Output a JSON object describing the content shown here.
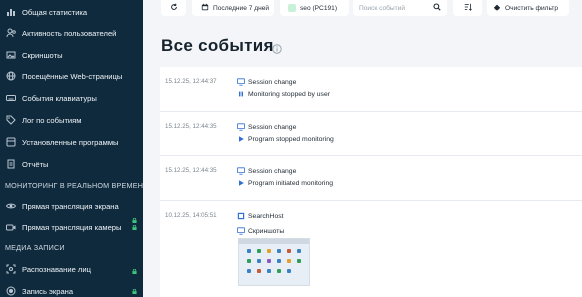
{
  "sidebar": {
    "items": [
      {
        "label": "Общая статистика",
        "icon": "chart-icon"
      },
      {
        "label": "Активность пользователей",
        "icon": "users-icon"
      },
      {
        "label": "Скриншоты",
        "icon": "image-icon"
      },
      {
        "label": "Посещённые Web-страницы",
        "icon": "globe-icon"
      },
      {
        "label": "События клавиатуры",
        "icon": "keyboard-icon"
      },
      {
        "label": "Лог по событиям",
        "icon": "tag-icon"
      },
      {
        "label": "Установленные программы",
        "icon": "box-icon"
      },
      {
        "label": "Отчёты",
        "icon": "report-icon"
      }
    ],
    "section_realtime": "МОНИТОРИНГ В РЕАЛЬНОМ ВРЕМЕНИ",
    "realtime_items": [
      {
        "label": "Прямая трансляция экрана",
        "icon": "eye-icon",
        "locked": true
      },
      {
        "label": "Прямая трансляция камеры",
        "icon": "camera-icon",
        "locked": true
      }
    ],
    "section_media": "МЕДИА ЗАПИСИ",
    "media_items": [
      {
        "label": "Распознавание лиц",
        "icon": "face-icon",
        "locked": true
      },
      {
        "label": "Запись экрана",
        "icon": "record-icon",
        "locked": true
      }
    ]
  },
  "toolbar": {
    "date_label": "Последние 7 дней",
    "user_label": "seo (PC191)",
    "search_placeholder": "Поиск событий",
    "clear_label": "Очистить фильтр"
  },
  "main": {
    "title": "Все события"
  },
  "events": [
    {
      "timestamp": "15.12.25, 12:44:37",
      "lines": [
        {
          "icon": "monitor-icon",
          "text": "Session change"
        },
        {
          "icon": "pause-icon",
          "text": "Monitoring stopped by user"
        }
      ]
    },
    {
      "timestamp": "15.12.25, 12:44:35",
      "lines": [
        {
          "icon": "monitor-icon",
          "text": "Session change"
        },
        {
          "icon": "play-icon",
          "text": "Program stopped monitoring"
        }
      ]
    },
    {
      "timestamp": "15.12.25, 12:44:35",
      "lines": [
        {
          "icon": "monitor-icon",
          "text": "Session change"
        },
        {
          "icon": "play-icon",
          "text": "Program initiated monitoring"
        }
      ]
    },
    {
      "timestamp": "10.12.25, 14:05:51",
      "lines": [
        {
          "icon": "app-icon",
          "text": "SearchHost"
        },
        {
          "icon": "monitor-icon",
          "text": "Скриншоты"
        }
      ]
    }
  ],
  "colors": {
    "sidebar_bg": "#0f2a3d",
    "accent": "#2f6fd6",
    "lock": "#3cc47c"
  }
}
